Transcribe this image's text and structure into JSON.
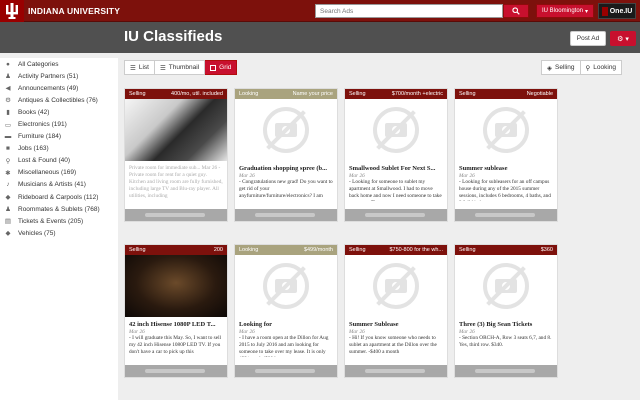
{
  "topbar": {
    "brand": "INDIANA UNIVERSITY",
    "search_placeholder": "Search Ads",
    "campus_label": "IU Bloomington",
    "oneiu_label": "One.IU"
  },
  "header": {
    "title": "IU Classifieds",
    "post_ad_label": "Post Ad"
  },
  "sidebar": {
    "items": [
      {
        "icon": "circle-icon",
        "label": "All Categories"
      },
      {
        "icon": "person-icon",
        "label": "Activity Partners (51)"
      },
      {
        "icon": "megaphone-icon",
        "label": "Announcements (49)"
      },
      {
        "icon": "gear-icon",
        "label": "Antiques & Collectibles (76)"
      },
      {
        "icon": "book-icon",
        "label": "Books (42)"
      },
      {
        "icon": "laptop-icon",
        "label": "Electronics (191)"
      },
      {
        "icon": "couch-icon",
        "label": "Furniture (184)"
      },
      {
        "icon": "briefcase-icon",
        "label": "Jobs (163)"
      },
      {
        "icon": "search-icon",
        "label": "Lost & Found (40)"
      },
      {
        "icon": "asterisk-icon",
        "label": "Miscellaneous (169)"
      },
      {
        "icon": "music-icon",
        "label": "Musicians & Artists (41)"
      },
      {
        "icon": "car-icon",
        "label": "Rideboard & Carpools (112)"
      },
      {
        "icon": "people-icon",
        "label": "Roommates & Sublets (768)"
      },
      {
        "icon": "ticket-icon",
        "label": "Tickets & Events (205)"
      },
      {
        "icon": "car-icon",
        "label": "Vehicles (75)"
      }
    ]
  },
  "views": {
    "list": "List",
    "thumbnail": "Thumbnail",
    "grid": "Grid"
  },
  "filters": {
    "selling": "Selling",
    "looking": "Looking"
  },
  "cards": [
    {
      "type": "Selling",
      "price": "400/mo, util. included",
      "image": "photo-stairs",
      "title": "",
      "date": "",
      "desc": "Private room for immediate sub... Mar 26 - Private room for rent for a quiet guy. Kitchen and living room are fully furnished, including large TV and Blu-ray player. All utilities, including"
    },
    {
      "type": "Looking",
      "price": "Name your price",
      "image": "placeholder",
      "title": "Graduation shopping spree (b...",
      "date": "Mar 26",
      "desc": " - Congratulations new grad! Do you want to get rid of your anyfurniture/furniture/electronics? I am"
    },
    {
      "type": "Selling",
      "price": "$700/month +electric",
      "image": "placeholder",
      "title": "Smallwood Sublet For Next S...",
      "date": "Mar 26",
      "desc": " - Looking for someone to sublet my apartment at Smallwood. I had to move back home and now I need someone to take my room. The"
    },
    {
      "type": "Selling",
      "price": "Negotiable",
      "image": "placeholder",
      "title": "Summer sublease",
      "date": "Mar 26",
      "desc": " - Looking for subleasers for an off campus house during any of the 2015 summer sessions, includes 6 bedrooms, 4 baths, and 2 full kitchens,"
    },
    {
      "type": "Selling",
      "price": "200",
      "image": "photo-tv",
      "title": "42 inch Hisense 1080P LED T...",
      "date": "Mar 26",
      "desc": " - I will graduate this May. So, I want to sell my 42 inch Hisense 1080P LED TV. If you don't have a car to pick up this"
    },
    {
      "type": "Looking",
      "price": "$499/month",
      "image": "placeholder",
      "title": "Looking for",
      "date": "Mar 26",
      "desc": " - I have a room open at the Dillon for Aug 2015 to July 2016 and am looking for someone to take over my lease. It is only 499/month ($80 less per"
    },
    {
      "type": "Selling",
      "price": "$750-800 for the wh...",
      "image": "placeholder",
      "title": "Summer Sublease",
      "date": "Mar 26",
      "desc": " - Hi! If you know someone who needs to sublet an apartment at the Dillon over the summer. -$400 a month"
    },
    {
      "type": "Selling",
      "price": "$360",
      "image": "placeholder",
      "title": "Three (3) Big Sean Tickets",
      "date": "Mar 26",
      "desc": " - Section ORCH-A, Row 3 seats 6,7, and 8. Yes, third row. $340."
    }
  ]
}
